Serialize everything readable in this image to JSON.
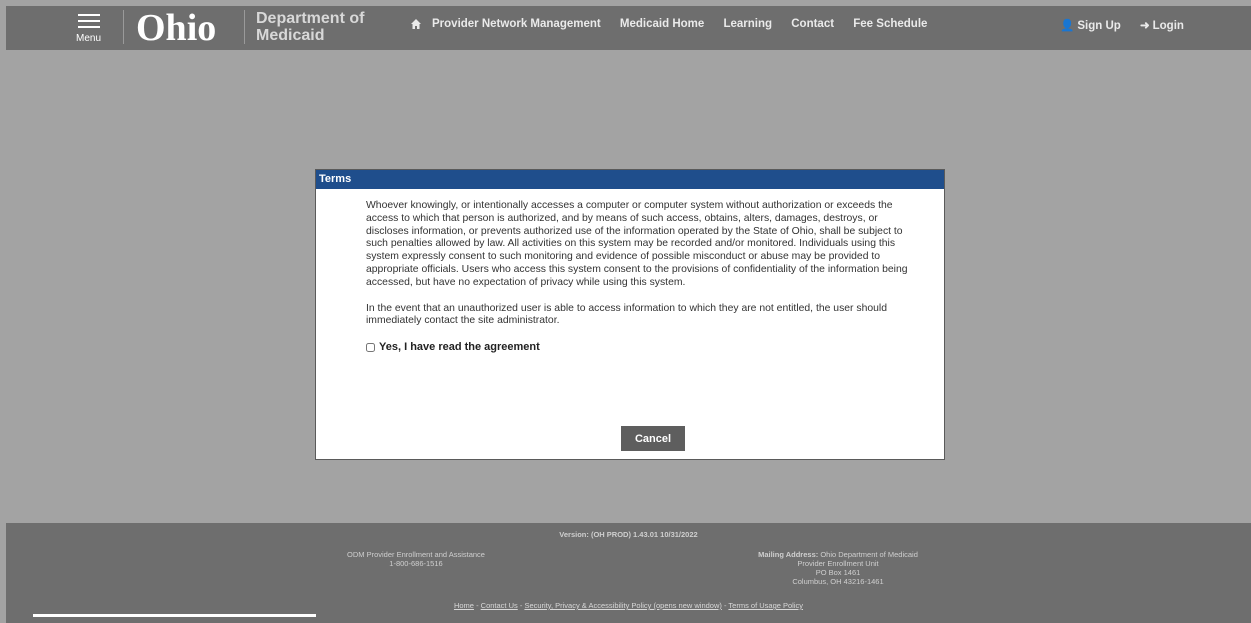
{
  "header": {
    "menu_label": "Menu",
    "logo_text": "Ohio",
    "dept_line1": "Department of",
    "dept_line2": "Medicaid",
    "nav": [
      "Provider Network Management",
      "Medicaid Home",
      "Learning",
      "Contact",
      "Fee Schedule"
    ],
    "signup": "Sign Up",
    "login": "Login"
  },
  "modal": {
    "title": "Terms",
    "para1": "Whoever knowingly, or intentionally accesses a computer or computer system without authorization or exceeds the access to which that person is authorized, and by means of such access, obtains, alters, damages, destroys, or discloses information, or prevents authorized use of the information operated by the State of Ohio, shall be subject to such penalties allowed by law. All activities on this system may be recorded and/or monitored. Individuals using this system expressly consent to such monitoring and evidence of possible misconduct or abuse may be provided to appropriate officials. Users who access this system consent to the provisions of confidentiality of the information being accessed, but have no expectation of privacy while using this system.",
    "para2": "In the event that an unauthorized user is able to access information to which they are not entitled, the user should immediately contact the site administrator.",
    "agree_label": "Yes, I have read the agreement",
    "cancel_label": "Cancel"
  },
  "footer": {
    "version": "Version: (OH PROD) 1.43.01 10/31/2022",
    "left_line1": "ODM Provider Enrollment and Assistance",
    "left_line2": "1-800-686-1516",
    "mailing_label": "Mailing Address:",
    "mailing_line1": "Ohio Department of Medicaid",
    "mailing_line2": "Provider Enrollment Unit",
    "mailing_line3": "PO Box 1461",
    "mailing_line4": "Columbus, OH 43216-1461",
    "links": [
      "Home",
      "Contact Us",
      "Security, Privacy & Accessibility Policy (opens new window)",
      "Terms of Usage Policy"
    ],
    "link_sep": " - "
  },
  "colors": {
    "topbar": "#6e6e6e",
    "backdrop": "#a3a3a3",
    "modal_header": "#1f4e8c",
    "cancel_button": "#5e5e5e"
  }
}
